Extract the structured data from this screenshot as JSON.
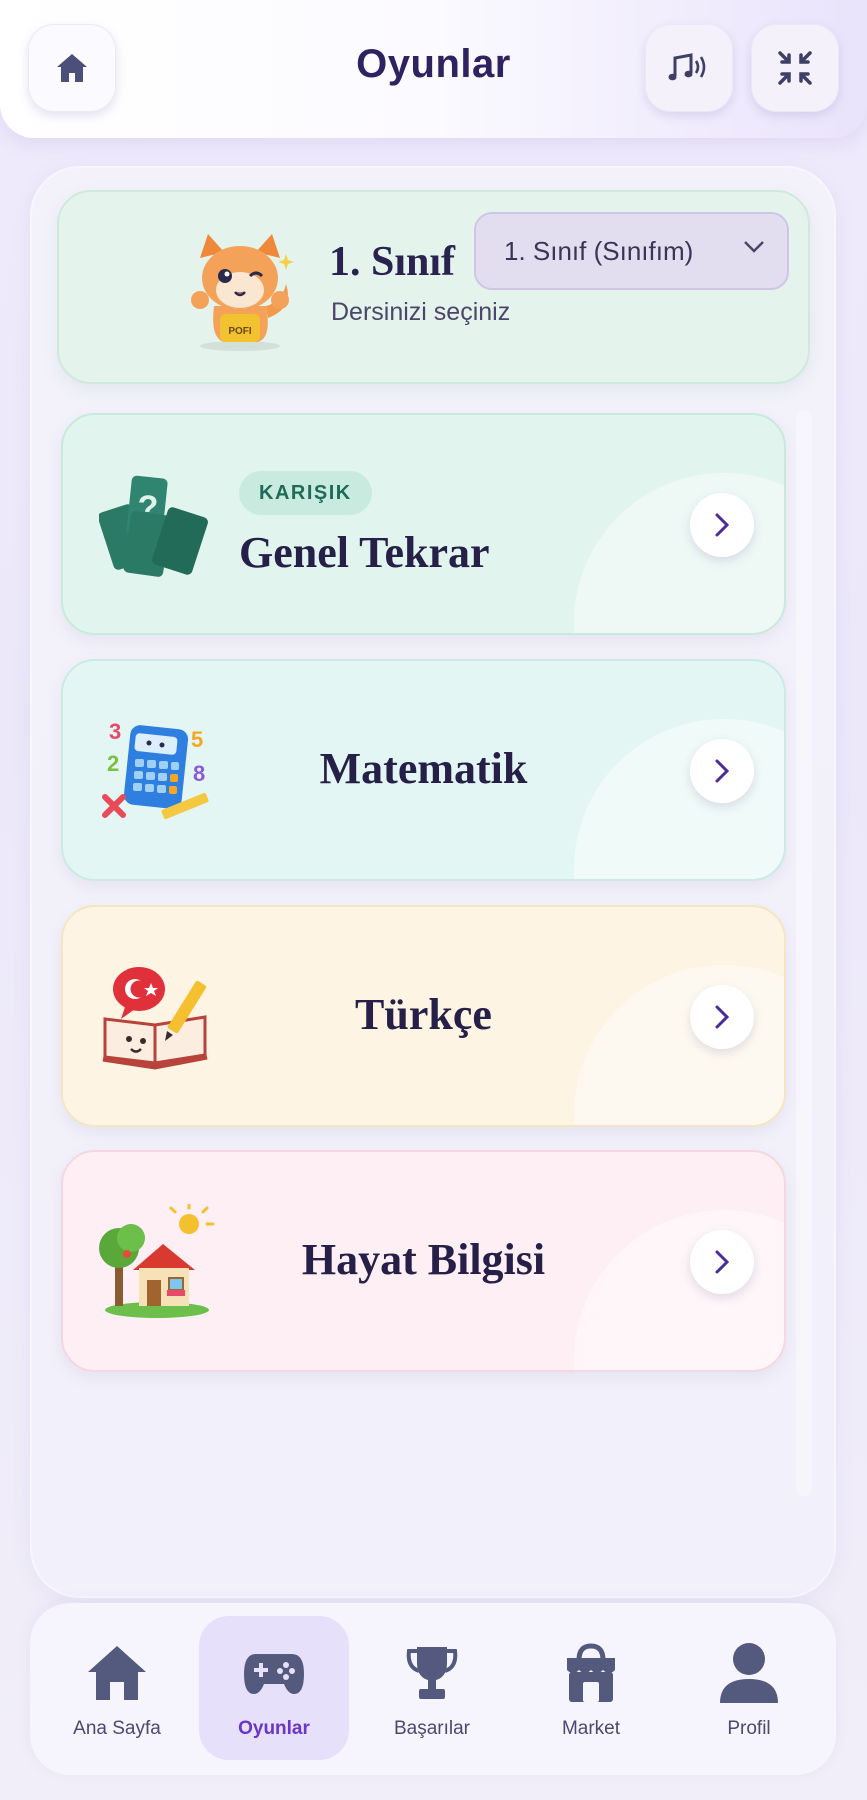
{
  "header": {
    "title": "Oyunlar",
    "home_icon": "home-icon",
    "music_icon": "music-icon",
    "shrink_icon": "exit-fullscreen-icon"
  },
  "class_card": {
    "title": "1. Sınıf",
    "subtitle": "Dersinizi seçiniz",
    "mascot_label": "POFI",
    "select_value": "1. Sınıf (Sınıfım)"
  },
  "subjects": [
    {
      "badge": "KARIŞIK",
      "label": "Genel Tekrar",
      "icon": "question-cards-icon",
      "color": "#e1f5ee"
    },
    {
      "label": "Matematik",
      "icon": "calculator-icon",
      "color": "#e4f6f3"
    },
    {
      "label": "Türkçe",
      "icon": "book-pencil-icon",
      "color": "#fdf4e4"
    },
    {
      "label": "Hayat Bilgisi",
      "icon": "house-tree-icon",
      "color": "#fdeff3"
    }
  ],
  "nav": [
    {
      "label": "Ana Sayfa",
      "icon": "home-icon",
      "active": false
    },
    {
      "label": "Oyunlar",
      "icon": "gamepad-icon",
      "active": true
    },
    {
      "label": "Başarılar",
      "icon": "trophy-icon",
      "active": false
    },
    {
      "label": "Market",
      "icon": "store-icon",
      "active": false
    },
    {
      "label": "Profil",
      "icon": "profile-icon",
      "active": false
    }
  ],
  "colors": {
    "accent": "#6a35c9",
    "title": "#2e2360",
    "nav_icon": "#545a7e"
  }
}
